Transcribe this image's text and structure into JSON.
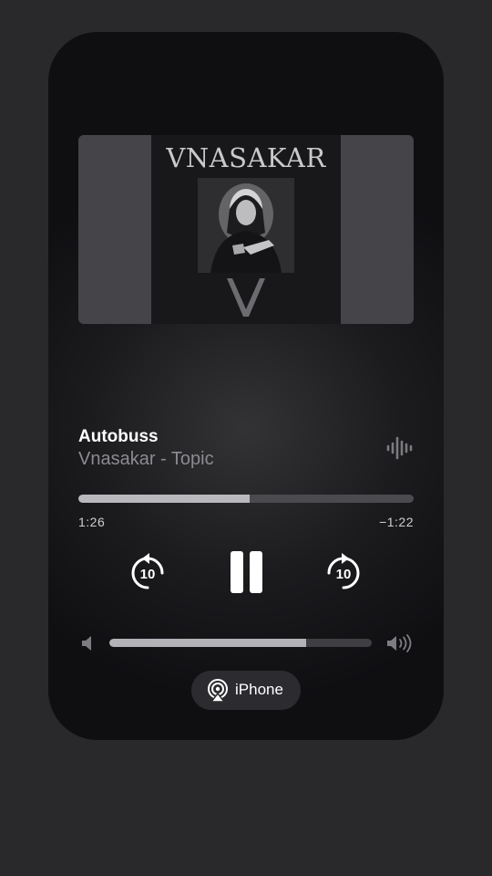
{
  "album": {
    "title": "VNASAKAR"
  },
  "track": {
    "title": "Autobuss",
    "artist": "Vnasakar - Topic"
  },
  "playback": {
    "elapsed": "1:26",
    "remaining": "−1:22",
    "progress_fraction": 0.51,
    "state": "playing"
  },
  "controls": {
    "skip_back_label": "10",
    "skip_forward_label": "10"
  },
  "volume": {
    "level_fraction": 0.75
  },
  "airplay": {
    "device_label": "iPhone"
  },
  "icons": {
    "waveform": "waveform-icon",
    "skip_back": "gobackward-10-icon",
    "pause": "pause-icon",
    "skip_forward": "goforward-10-icon",
    "volume_low": "speaker-low-icon",
    "volume_high": "speaker-high-icon",
    "airplay": "airplay-audio-icon"
  },
  "colors": {
    "background": "#29282b",
    "card": "#1b1a1d",
    "progress_fill": "#b9b8bd",
    "progress_track": "#4b4a4f",
    "secondary_text": "#8c8b90"
  }
}
